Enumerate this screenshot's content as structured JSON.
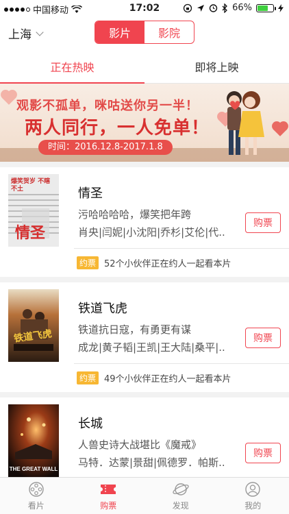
{
  "status_bar": {
    "carrier": "中国移动",
    "time": "17:02",
    "battery": "66%",
    "battery_level": 0.66
  },
  "header": {
    "city": "上海",
    "segments": [
      "影片",
      "影院"
    ],
    "active_segment": 0
  },
  "tabs": [
    {
      "label": "正在热映",
      "active": true
    },
    {
      "label": "即将上映",
      "active": false
    }
  ],
  "banner": {
    "line1": "观影不孤单，咪咕送你另一半！",
    "line2": "两人同行，一人免单！",
    "date": "时间：2016.12.8-2017.1.8"
  },
  "movies": [
    {
      "title": "情圣",
      "desc": "污哈哈哈哈，爆笑把年跨",
      "cast": "肖央|闫妮|小沈阳|乔杉|艾伦|代..",
      "buy_label": "购票",
      "yue_tag": "约票",
      "yue_text": "52个小伙伴正在约人一起看本片",
      "poster_text": "情圣",
      "poster_caption": "爆笑贺岁 不瞎不土"
    },
    {
      "title": "铁道飞虎",
      "desc": "铁道抗日寇，有勇更有谋",
      "cast": "成龙|黄子韬|王凯|王大陆|桑平|..",
      "buy_label": "购票",
      "yue_tag": "约票",
      "yue_text": "49个小伙伴正在约人一起看本片",
      "poster_text": "铁道飞虎"
    },
    {
      "title": "长城",
      "desc": "人兽史诗大战堪比《魔戒》",
      "cast": "马特．达蒙|景甜|佩德罗．帕斯..",
      "buy_label": "购票",
      "poster_text": "THE GREAT WALL"
    }
  ],
  "tabbar": [
    {
      "label": "看片",
      "icon": "film-reel-icon",
      "active": false
    },
    {
      "label": "购票",
      "icon": "ticket-icon",
      "active": true
    },
    {
      "label": "发现",
      "icon": "planet-icon",
      "active": false
    },
    {
      "label": "我的",
      "icon": "user-icon",
      "active": false
    }
  ],
  "colors": {
    "accent": "#f0444f",
    "yue_tag": "#f7b733"
  }
}
